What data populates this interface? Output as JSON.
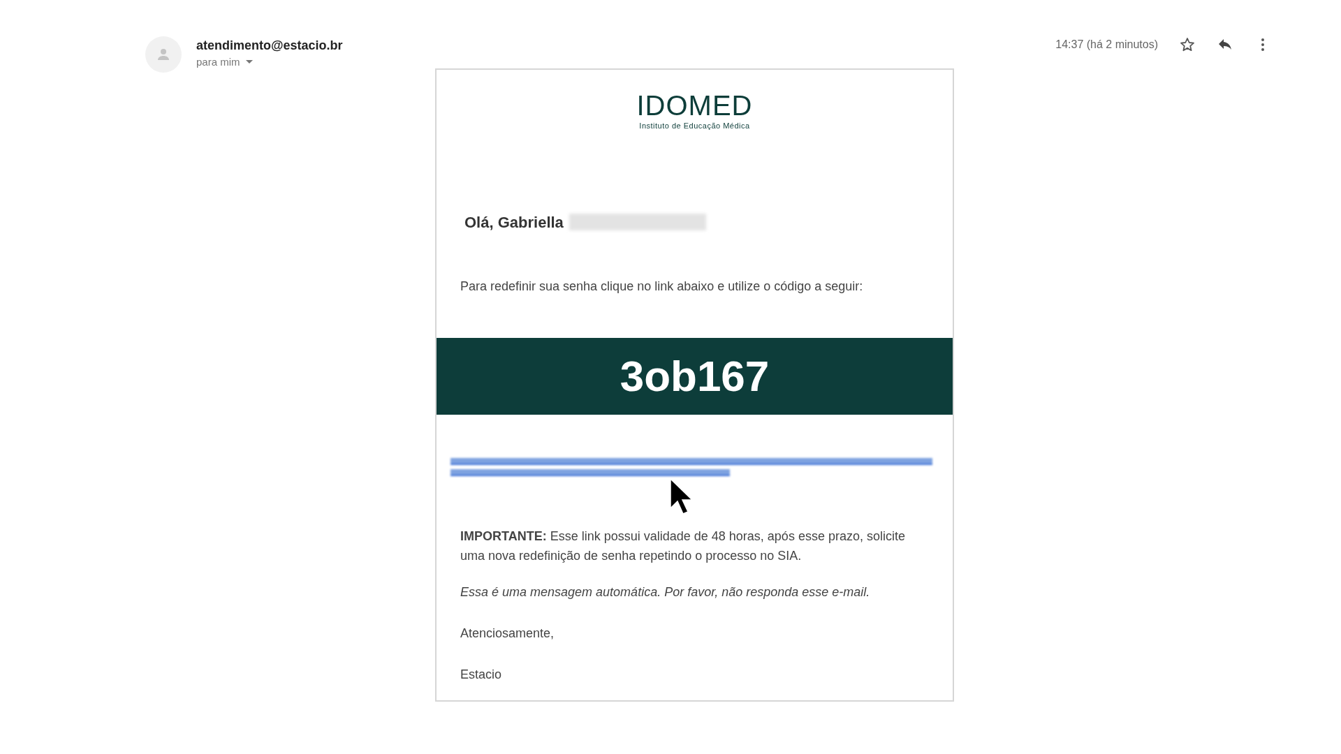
{
  "sender": {
    "email": "atendimento@estacio.br",
    "recipient": "para mim"
  },
  "time": "14:37 (há 2 minutos)",
  "email": {
    "logo": {
      "name": "IDOMED",
      "tagline": "Instituto de Educação Médica"
    },
    "greeting": "Olá, Gabriella",
    "intro": "Para redefinir sua senha clique no link abaixo e utilize o código a seguir:",
    "code": "3ob167",
    "important": "**IMPORTANTE:** Esse link possui validade de 48 horas, após esse prazo, solicite uma nova redefinição de senha repetindo o processo no SIA.",
    "auto_note": "Essa é uma mensagem automática. Por favor, não responda esse e-mail.",
    "closing": "Atenciosamente,",
    "signature": "Estacio"
  }
}
